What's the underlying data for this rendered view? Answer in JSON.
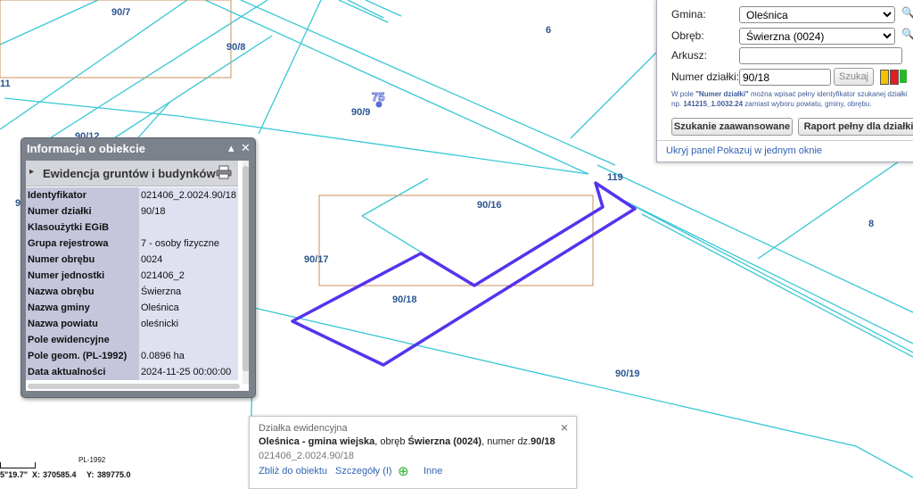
{
  "map": {
    "parcel_labels": [
      "90/7",
      "90/8",
      "6",
      "90/9",
      "90/12",
      "90/16",
      "90/17",
      "90/18",
      "90/19",
      "119",
      "8",
      "11",
      "9"
    ],
    "marker_number": "75",
    "colors": {
      "parcel_lines": "#38c7d6",
      "selected_outline": "#5533ee",
      "frame": "#c9925a",
      "label": "#2b5690"
    }
  },
  "info_window": {
    "title": "Informacja o obiekcie",
    "minimize_icon": "▴",
    "close_icon": "✕",
    "section_label": "Ewidencja gruntów i budynków",
    "rows": [
      {
        "key": "Identyfikator",
        "value": "021406_2.0024.90/18"
      },
      {
        "key": "Numer działki",
        "value": "90/18"
      },
      {
        "key": "Klasoużytki EGiB",
        "value": ""
      },
      {
        "key": "Grupa rejestrowa",
        "value": "7 - osoby fizyczne"
      },
      {
        "key": "Numer obrębu",
        "value": "0024"
      },
      {
        "key": "Numer jednostki",
        "value": "021406_2"
      },
      {
        "key": "Nazwa obrębu",
        "value": "Świerzna"
      },
      {
        "key": "Nazwa gminy",
        "value": "Oleśnica"
      },
      {
        "key": "Nazwa powiatu",
        "value": "oleśnicki"
      },
      {
        "key": "Pole ewidencyjne",
        "value": ""
      },
      {
        "key": "Pole geom. (PL-1992)",
        "value": "0.0896 ha"
      },
      {
        "key": "Data aktualności",
        "value": "2024-11-25 00:00:00"
      }
    ]
  },
  "search_panel": {
    "gmina_label": "Gmina:",
    "gmina_value": "Oleśnica",
    "obreb_label": "Obręb:",
    "obreb_value": "Świerzna (0024)",
    "arkusz_label": "Arkusz:",
    "arkusz_value": "",
    "numer_label": "Numer działki:",
    "numer_value": "90/18",
    "search_button": "Szukaj",
    "status_colors": [
      "#f2c200",
      "#e02020",
      "#2db52d"
    ],
    "hint_prefix": "W pole ",
    "hint_bold": "\"Numer działki\"",
    "hint_mid": " można wpisać pełny identyfikator szukanej działki",
    "hint_np": "np. ",
    "hint_example": "141215_1.0032.24",
    "hint_end": " zamiast wyboru powiatu, gminy, obrębu.",
    "advanced_button": "Szukanie zaawansowane",
    "report_button": "Raport pełny dla działki",
    "hide_link": "Ukryj panel",
    "show_link": "Pokazuj w jednym oknie"
  },
  "popup": {
    "header": "Działka ewidencyjna",
    "line_bold1": "Oleśnica - gmina wiejska",
    "line_mid1": ", obręb ",
    "line_bold2": "Świerzna (0024)",
    "line_mid2": ", numer dz.",
    "line_bold3": "90/18",
    "identifier": "021406_2.0024.90/18",
    "zoom_link": "Zbliż do obiektu",
    "details_link": "Szczegóły (I)",
    "plus_icon": "⊕",
    "other_link": "Inne",
    "close_icon": "⨯"
  },
  "status_bar": {
    "crs": "PL-1992",
    "coord_partial": "5\"19.7\"",
    "x_label": "X:",
    "x_value": "370585.4",
    "y_label": "Y:",
    "y_value": "389775.0"
  }
}
